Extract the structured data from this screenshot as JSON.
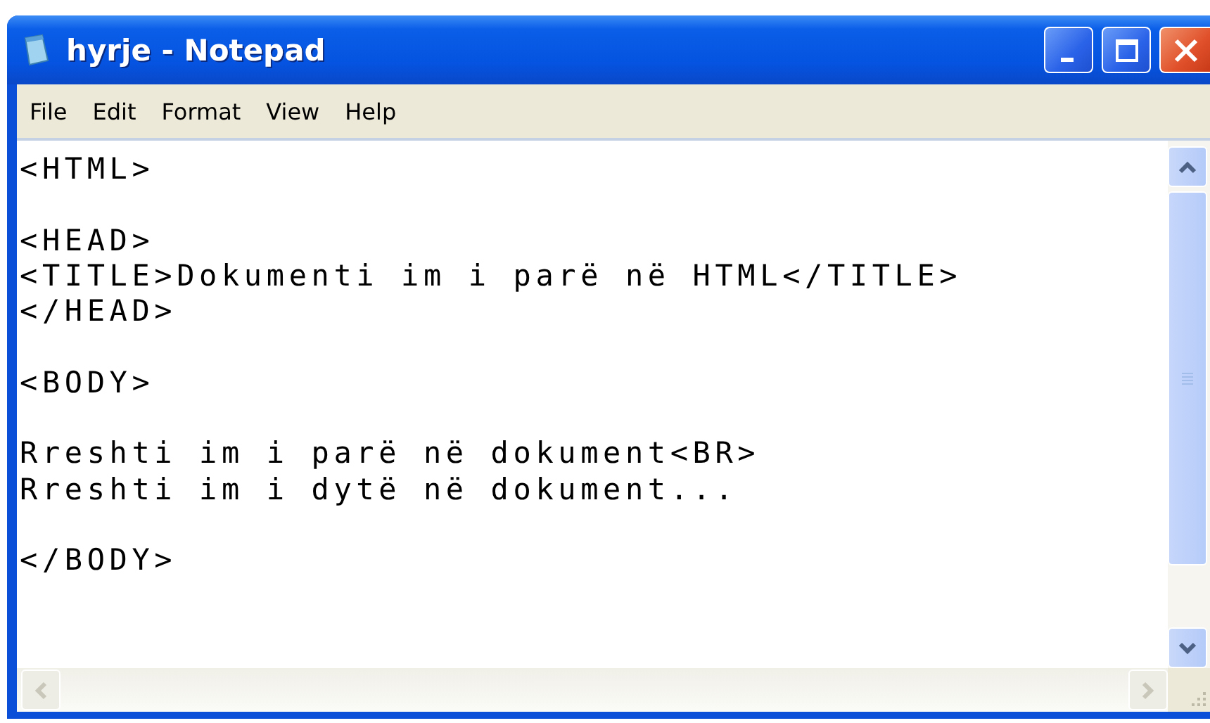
{
  "window": {
    "title": "hyrje - Notepad"
  },
  "menu": [
    "File",
    "Edit",
    "Format",
    "View",
    "Help"
  ],
  "document": {
    "text": "<HTML>\n\n<HEAD>\n<TITLE>Dokumenti im i parë në HTML</TITLE>\n</HEAD>\n\n<BODY>\n\nRreshti im i parë në dokument<BR>\nRreshti im i dytë në dokument...\n\n</BODY>"
  }
}
